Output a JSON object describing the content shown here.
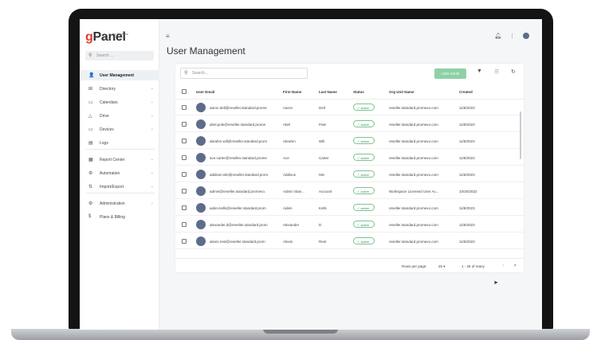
{
  "app": {
    "logo_g": "g",
    "logo_rest": "Panel",
    "logo_sup": "by Promevo"
  },
  "sidebar": {
    "search_placeholder": "Search ...",
    "items": [
      {
        "label": "User Management",
        "icon": "person-icon",
        "glyph": "👤",
        "chevron": ""
      },
      {
        "label": "Directory",
        "icon": "org-chart-icon",
        "glyph": "⊞",
        "chevron": "⌄"
      },
      {
        "label": "Calendars",
        "icon": "calendar-icon",
        "glyph": "▭",
        "chevron": "⌄"
      },
      {
        "label": "Drive",
        "icon": "drive-icon",
        "glyph": "△",
        "chevron": "⌄"
      },
      {
        "label": "Devices",
        "icon": "devices-icon",
        "glyph": "▭",
        "chevron": "⌄"
      },
      {
        "label": "Logs",
        "icon": "logs-icon",
        "glyph": "▤",
        "chevron": ""
      },
      {
        "label": "Report Center",
        "icon": "report-icon",
        "glyph": "▦",
        "chevron": "⌄"
      },
      {
        "label": "Automation",
        "icon": "gear-icon",
        "glyph": "⚙",
        "chevron": "⌄"
      },
      {
        "label": "Import/Export",
        "icon": "import-export-icon",
        "glyph": "⇅",
        "chevron": "⌄"
      },
      {
        "label": "Administration",
        "icon": "admin-icon",
        "glyph": "⚙",
        "chevron": "⌄"
      },
      {
        "label": "Plans & Billing",
        "icon": "dollar-icon",
        "glyph": "$",
        "chevron": ""
      }
    ]
  },
  "header": {
    "title": "User Management"
  },
  "toolbar": {
    "search_placeholder": "Search...",
    "add_label": "ADD NEW"
  },
  "table": {
    "columns": [
      "User Email",
      "First Name",
      "Last Name",
      "Status",
      "Org Unit Name",
      "Created"
    ],
    "rows": [
      [
        "aaron.dell@reseller.standard.prome",
        "Aaron",
        "Dell",
        "active",
        "reseller.standard.promevo.com",
        "11/8/2023"
      ],
      [
        "abel.pole@reseller.standard.prome",
        "Abel",
        "Pole",
        "active",
        "reseller.standard.promevo.com",
        "11/8/2023"
      ],
      [
        "abrahm.will@reseller.standard.prom",
        "Abrahm",
        "Will",
        "active",
        "reseller.standard.promevo.com",
        "11/8/2023"
      ],
      [
        "ace.carter@reseller.standard.prome",
        "Ace",
        "Carter",
        "active",
        "reseller.standard.promevo.com",
        "11/8/2023"
      ],
      [
        "addison.isle@reseller.standard.prom",
        "Addison",
        "Isle",
        "active",
        "reseller.standard.promevo.com",
        "11/8/2023"
      ],
      [
        "admin@reseller.standard.promevo.",
        "Admin Stan...",
        "Account",
        "active",
        "Workspace Licensed User Ac...",
        "10/20/2022"
      ],
      [
        "aiden.kells@reseller.standard.prom",
        "Aiden",
        "Kells",
        "active",
        "reseller.standard.promevo.com",
        "11/8/2023"
      ],
      [
        "alexander.d@reseller.standard.prom",
        "Alexander",
        "D",
        "active",
        "reseller.standard.promevo.com",
        "11/8/2023"
      ],
      [
        "alexis.rest@reseller.standard.prom",
        "Alexis",
        "Rest",
        "active",
        "reseller.standard.promevo.com",
        "11/8/2023"
      ]
    ]
  },
  "footer": {
    "rows_per_page_label": "Rows per page:",
    "rows_per_page_value": "25",
    "range": "1 - 25 of many"
  },
  "colors": {
    "accent": "#8fd0a6",
    "active_badge": "#3a8f53",
    "avatar": "#5c6d8a"
  }
}
